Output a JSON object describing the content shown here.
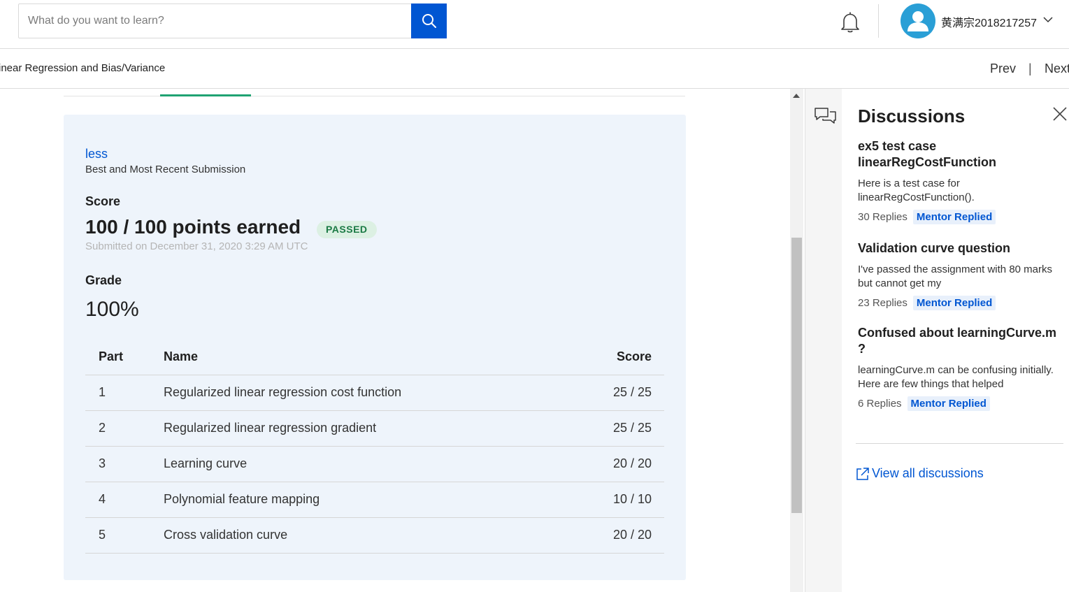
{
  "header": {
    "search_placeholder": "What do you want to learn?",
    "username": "黄满宗2018217257",
    "accent_color": "#0056d2"
  },
  "subheader": {
    "course_title": "inear Regression and Bias/Variance",
    "prev_label": "Prev",
    "separator": "|",
    "next_label": "Next"
  },
  "submission": {
    "less_link": "less",
    "subtitle": "Best and Most Recent Submission",
    "score_label": "Score",
    "points_text": "100 / 100 points earned",
    "status_badge": "PASSED",
    "submitted_text": "Submitted on December 31, 2020 3:29 AM UTC",
    "grade_label": "Grade",
    "grade_value": "100%",
    "table": {
      "headers": {
        "part": "Part",
        "name": "Name",
        "score": "Score"
      },
      "rows": [
        {
          "part": "1",
          "name": "Regularized linear regression cost function",
          "score": "25 / 25"
        },
        {
          "part": "2",
          "name": "Regularized linear regression gradient",
          "score": "25 / 25"
        },
        {
          "part": "3",
          "name": "Learning curve",
          "score": "20 / 20"
        },
        {
          "part": "4",
          "name": "Polynomial feature mapping",
          "score": "10 / 10"
        },
        {
          "part": "5",
          "name": "Cross validation curve",
          "score": "20 / 20"
        }
      ]
    }
  },
  "discussions": {
    "title": "Discussions",
    "threads": [
      {
        "title": "ex5 test case linearRegCostFunction",
        "snippet": "Here is a test case for linearRegCostFunction().",
        "replies": "30 Replies",
        "badge": "Mentor Replied"
      },
      {
        "title": "Validation curve question",
        "snippet": "I've passed the assignment with 80 marks but cannot get my",
        "replies": "23 Replies",
        "badge": "Mentor Replied"
      },
      {
        "title": "Confused about learningCurve.m ?",
        "snippet": "learningCurve.m can be confusing initially. Here are few things that helped",
        "replies": "6 Replies",
        "badge": "Mentor Replied"
      }
    ],
    "view_all": "View all discussions"
  }
}
